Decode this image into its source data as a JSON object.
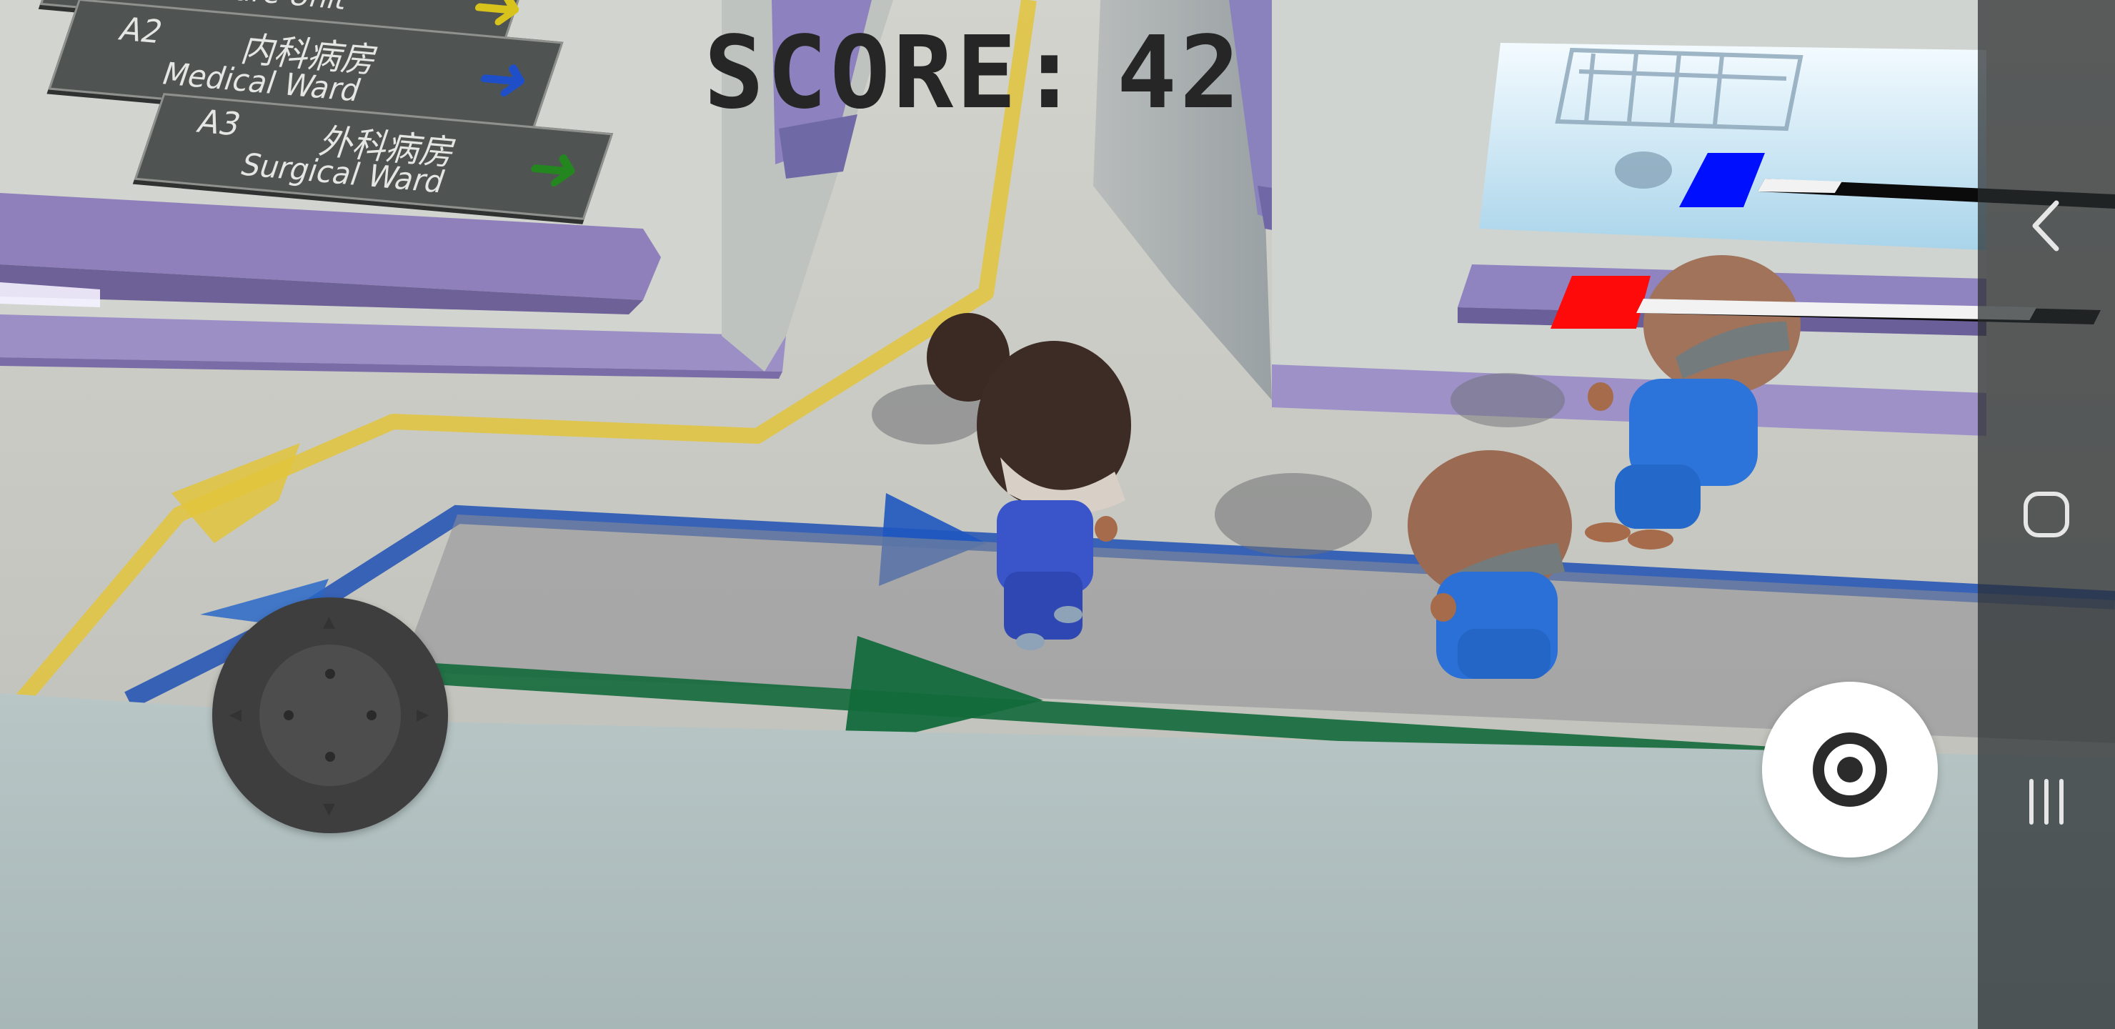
{
  "hud": {
    "score_label": "SCORE:",
    "score_value": "42",
    "blue_meter": {
      "color": "#0010ff",
      "fill_fraction": 0.22
    },
    "red_meter": {
      "color": "#ff0a0a",
      "fill_fraction": 0.86
    }
  },
  "signs": [
    {
      "code": "",
      "cn": "",
      "en": "Intensive Care Unit",
      "arrow_color": "#d8c21c"
    },
    {
      "code": "A2",
      "cn": "内科病房",
      "en": "Medical Ward",
      "arrow_color": "#1f4fc8"
    },
    {
      "code": "A3",
      "cn": "外科病房",
      "en": "Surgical Ward",
      "arrow_color": "#23861e"
    }
  ],
  "controls": {
    "joystick_icon": "dpad-joystick-icon",
    "action_icon": "target-ring-icon"
  },
  "system_nav": {
    "back_icon": "chevron-left-icon",
    "home_icon": "rounded-square-icon",
    "recents_icon": "three-bars-icon"
  },
  "colors": {
    "floor": "#c9c8c2",
    "wall_purple": "#8c7fb8",
    "yellow_line": "#e0c23a",
    "blue_line": "#1e4fb0",
    "green_line": "#126b3a",
    "scrub_blue": "#2a6fd6",
    "nurse_scrub": "#3a55c9"
  }
}
